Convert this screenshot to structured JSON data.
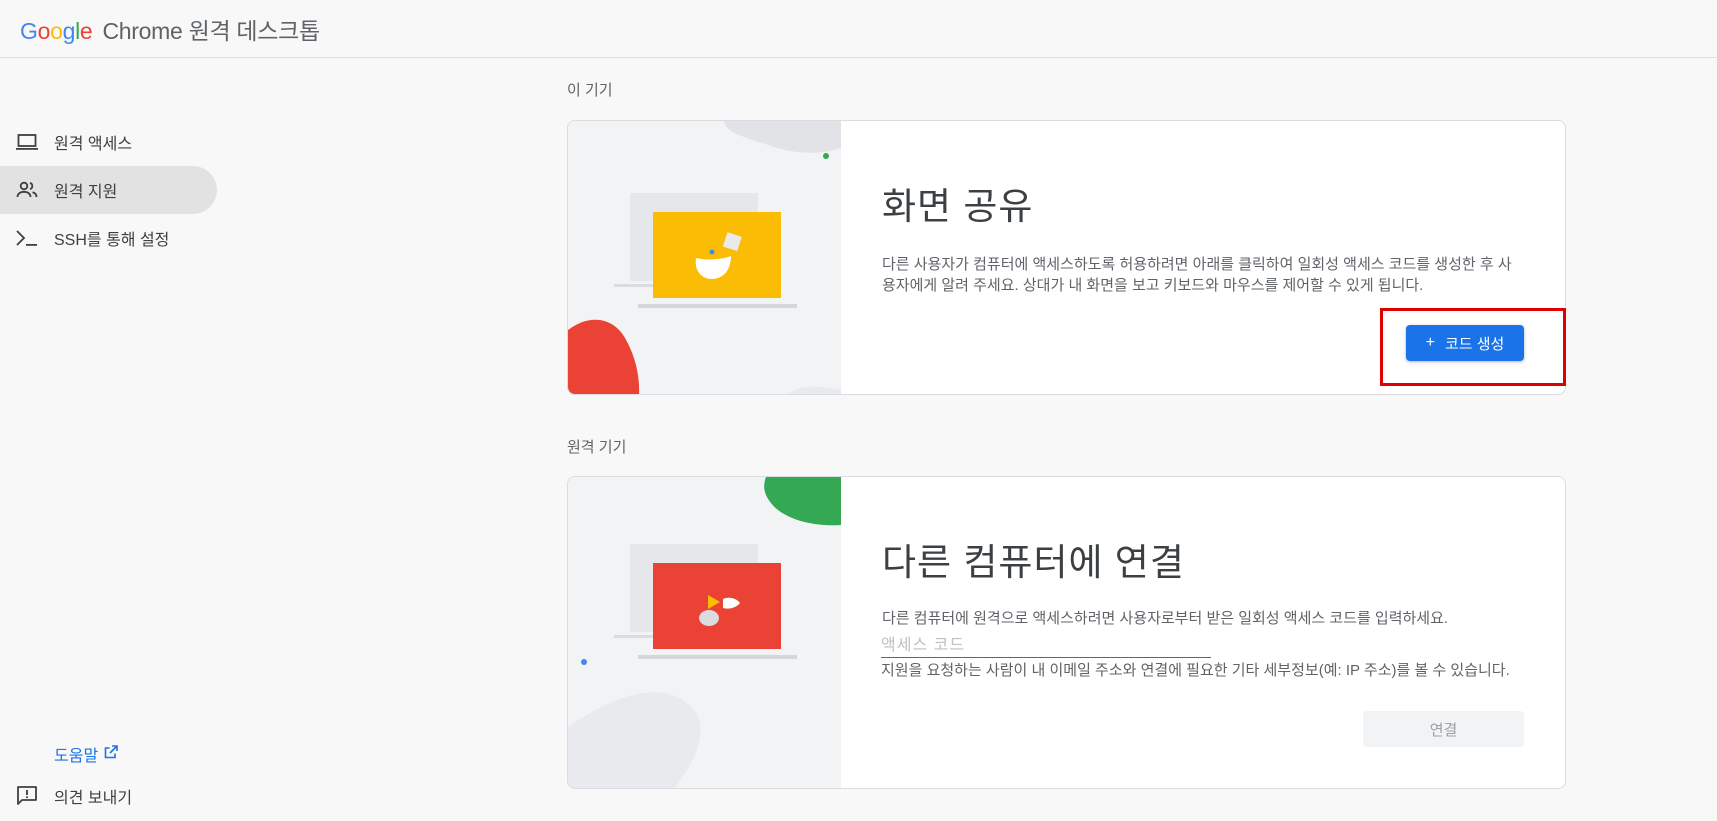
{
  "header": {
    "logo_letters": [
      "G",
      "o",
      "o",
      "g",
      "l",
      "e"
    ],
    "product": "Chrome 원격 데스크톱"
  },
  "sidebar": {
    "items": [
      {
        "label": "원격 액세스",
        "icon": "laptop-icon",
        "active": false
      },
      {
        "label": "원격 지원",
        "icon": "people-icon",
        "active": true
      },
      {
        "label": "SSH를 통해 설정",
        "icon": "terminal-icon",
        "active": false
      }
    ],
    "help_label": "도움말",
    "feedback_label": "의견 보내기"
  },
  "this_device": {
    "section_label": "이 기기",
    "title": "화면 공유",
    "description": "다른 사용자가 컴퓨터에 액세스하도록 허용하려면 아래를 클릭하여 일회성 액세스 코드를 생성한 후 사용자에게 알려 주세요. 상대가 내 화면을 보고 키보드와 마우스를 제어할 수 있게 됩니다.",
    "button_icon": "+",
    "button_label": "코드 생성"
  },
  "remote_device": {
    "section_label": "원격 기기",
    "title": "다른 컴퓨터에 연결",
    "description": "다른 컴퓨터에 원격으로 액세스하려면 사용자로부터 받은 일회성 액세스 코드를 입력하세요.",
    "input_placeholder": "액세스 코드",
    "input_value": "",
    "hint": "지원을 요청하는 사람이 내 이메일 주소와 연결에 필요한 기타 세부정보(예: IP 주소)를 볼 수 있습니다.",
    "connect_label": "연결"
  },
  "colors": {
    "accent": "#1a73e8",
    "yellow": "#fbbc05",
    "red": "#ea4335",
    "green": "#34a853",
    "highlight": "#e00000"
  }
}
